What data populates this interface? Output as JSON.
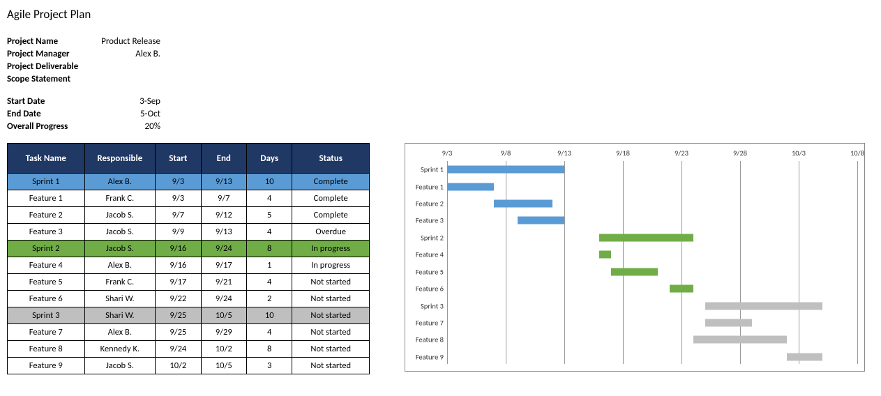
{
  "title": "Agile Project Plan",
  "meta1": [
    {
      "label": "Project Name",
      "value": "Product Release"
    },
    {
      "label": "Project Manager",
      "value": "Alex B."
    },
    {
      "label": "Project Deliverable",
      "value": ""
    },
    {
      "label": "Scope Statement",
      "value": ""
    }
  ],
  "meta2": [
    {
      "label": "Start Date",
      "value": "3-Sep"
    },
    {
      "label": "End Date",
      "value": "5-Oct"
    },
    {
      "label": "Overall Progress",
      "value": "20%"
    }
  ],
  "table": {
    "headers": [
      "Task Name",
      "Responsible",
      "Start",
      "End",
      "Days",
      "Status"
    ],
    "rows": [
      {
        "cls": "sprint-1",
        "cells": [
          "Sprint 1",
          "Alex B.",
          "9/3",
          "9/13",
          "10",
          "Complete"
        ]
      },
      {
        "cls": "",
        "cells": [
          "Feature 1",
          "Frank C.",
          "9/3",
          "9/7",
          "4",
          "Complete"
        ]
      },
      {
        "cls": "",
        "cells": [
          "Feature 2",
          "Jacob S.",
          "9/7",
          "9/12",
          "5",
          "Complete"
        ]
      },
      {
        "cls": "",
        "cells": [
          "Feature 3",
          "Jacob S.",
          "9/9",
          "9/13",
          "4",
          "Overdue"
        ]
      },
      {
        "cls": "sprint-2",
        "cells": [
          "Sprint 2",
          "Jacob S.",
          "9/16",
          "9/24",
          "8",
          "In progress"
        ]
      },
      {
        "cls": "",
        "cells": [
          "Feature 4",
          "Alex B.",
          "9/16",
          "9/17",
          "1",
          "In progress"
        ]
      },
      {
        "cls": "",
        "cells": [
          "Feature 5",
          "Frank C.",
          "9/17",
          "9/21",
          "4",
          "Not started"
        ]
      },
      {
        "cls": "",
        "cells": [
          "Feature 6",
          "Shari W.",
          "9/22",
          "9/24",
          "2",
          "Not started"
        ]
      },
      {
        "cls": "sprint-3",
        "cells": [
          "Sprint 3",
          "Shari W.",
          "9/25",
          "10/5",
          "10",
          "Not started"
        ]
      },
      {
        "cls": "",
        "cells": [
          "Feature 7",
          "Alex B.",
          "9/25",
          "9/29",
          "4",
          "Not started"
        ]
      },
      {
        "cls": "",
        "cells": [
          "Feature 8",
          "Kennedy K.",
          "9/24",
          "10/2",
          "8",
          "Not started"
        ]
      },
      {
        "cls": "",
        "cells": [
          "Feature 9",
          "Jacob S.",
          "10/2",
          "10/5",
          "3",
          "Not started"
        ]
      }
    ]
  },
  "chart_data": {
    "type": "bar",
    "orientation": "horizontal",
    "title": "",
    "xlabel": "",
    "ylabel": "",
    "x_axis_ticks": [
      "9/3",
      "9/8",
      "9/13",
      "9/18",
      "9/23",
      "9/28",
      "10/3",
      "10/8"
    ],
    "x_domain_days": [
      3,
      38
    ],
    "categories": [
      "Sprint 1",
      "Feature 1",
      "Feature 2",
      "Feature 3",
      "Sprint 2",
      "Feature 4",
      "Feature 5",
      "Feature 6",
      "Sprint 3",
      "Feature 7",
      "Feature 8",
      "Feature 9"
    ],
    "series": [
      {
        "name": "Sprint 1",
        "start": 3,
        "end": 13,
        "group": "blue"
      },
      {
        "name": "Feature 1",
        "start": 3,
        "end": 7,
        "group": "blue"
      },
      {
        "name": "Feature 2",
        "start": 7,
        "end": 12,
        "group": "blue"
      },
      {
        "name": "Feature 3",
        "start": 9,
        "end": 13,
        "group": "blue"
      },
      {
        "name": "Sprint 2",
        "start": 16,
        "end": 24,
        "group": "green"
      },
      {
        "name": "Feature 4",
        "start": 16,
        "end": 17,
        "group": "green"
      },
      {
        "name": "Feature 5",
        "start": 17,
        "end": 21,
        "group": "green"
      },
      {
        "name": "Feature 6",
        "start": 22,
        "end": 24,
        "group": "green"
      },
      {
        "name": "Sprint 3",
        "start": 25,
        "end": 35,
        "group": "gray"
      },
      {
        "name": "Feature 7",
        "start": 25,
        "end": 29,
        "group": "gray"
      },
      {
        "name": "Feature 8",
        "start": 24,
        "end": 32,
        "group": "gray"
      },
      {
        "name": "Feature 9",
        "start": 32,
        "end": 35,
        "group": "gray"
      }
    ],
    "colors": {
      "blue": "#5B9BD5",
      "green": "#70AD47",
      "gray": "#BFBFBF"
    }
  }
}
